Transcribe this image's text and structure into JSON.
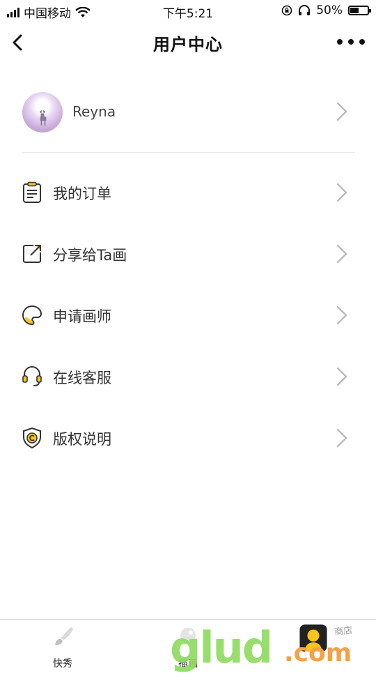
{
  "status_bar": {
    "carrier": "中国移动",
    "time": "下午5:21",
    "battery_percent": "50%",
    "battery_level": 0.5,
    "icons": [
      "signal-icon",
      "wifi-icon",
      "lock-rotation-icon",
      "headphones-icon",
      "battery-icon"
    ]
  },
  "nav": {
    "title": "用户中心",
    "back_icon": "chevron-left-icon",
    "more_icon": "more-dots-icon"
  },
  "profile": {
    "username": "Reyna"
  },
  "menu": [
    {
      "label": "我的订单",
      "icon": "order-list-icon"
    },
    {
      "label": "分享给Ta画",
      "icon": "share-icon"
    },
    {
      "label": "申请画师",
      "icon": "palette-icon"
    },
    {
      "label": "在线客服",
      "icon": "headset-icon"
    },
    {
      "label": "版权说明",
      "icon": "copyright-shield-icon"
    }
  ],
  "tabs": [
    {
      "label": "快秀",
      "icon": "brush-icon"
    },
    {
      "label": "插画",
      "icon": "illustration-icon"
    },
    {
      "label": "",
      "icon": "user-icon"
    }
  ],
  "watermark": {
    "main": "glud",
    "suffix": ".com",
    "shop": "商店"
  },
  "colors": {
    "accent_yellow": "#f7c51c",
    "icon_dark": "#333333",
    "chevron": "#bbbbbb",
    "divider": "#e6e6e6"
  }
}
